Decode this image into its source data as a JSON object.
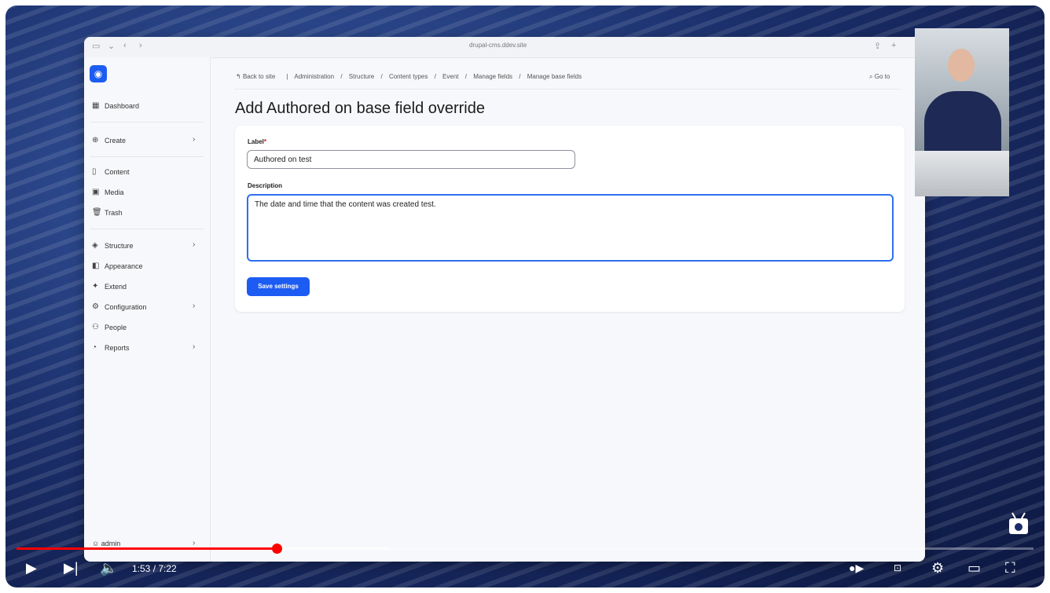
{
  "browser": {
    "url": "drupal-cms.ddev.site"
  },
  "sidebar": {
    "items": [
      {
        "label": "Dashboard",
        "icon": "dashboard-icon"
      },
      {
        "label": "Create",
        "icon": "plus-circle-icon"
      },
      {
        "label": "Content",
        "icon": "document-icon"
      },
      {
        "label": "Media",
        "icon": "image-icon"
      },
      {
        "label": "Trash",
        "icon": "trash-icon"
      },
      {
        "label": "Structure",
        "icon": "layers-icon"
      },
      {
        "label": "Appearance",
        "icon": "paint-icon"
      },
      {
        "label": "Extend",
        "icon": "puzzle-icon"
      },
      {
        "label": "Configuration",
        "icon": "gear-icon"
      },
      {
        "label": "People",
        "icon": "people-icon"
      },
      {
        "label": "Reports",
        "icon": "chart-icon"
      }
    ],
    "user": "admin"
  },
  "breadcrumb": {
    "back": "Back to site",
    "items": [
      "Administration",
      "/",
      "Structure",
      "/",
      "Content types",
      "/",
      "Event",
      "/",
      "Manage fields",
      "/",
      "Manage base fields"
    ],
    "goto": "Go to"
  },
  "page": {
    "title": "Add Authored on base field override"
  },
  "form": {
    "label_label": "Label",
    "label_required": "*",
    "label_value": "Authored on test",
    "description_label": "Description",
    "description_value": "The date and time that the content was created test.",
    "save_label": "Save settings"
  },
  "player": {
    "time": "1:53 / 7:22",
    "progress_fraction": 0.256,
    "buffered_fraction": 0.366
  },
  "colors": {
    "accent": "#1d5cf2",
    "progress": "#ff0000"
  }
}
